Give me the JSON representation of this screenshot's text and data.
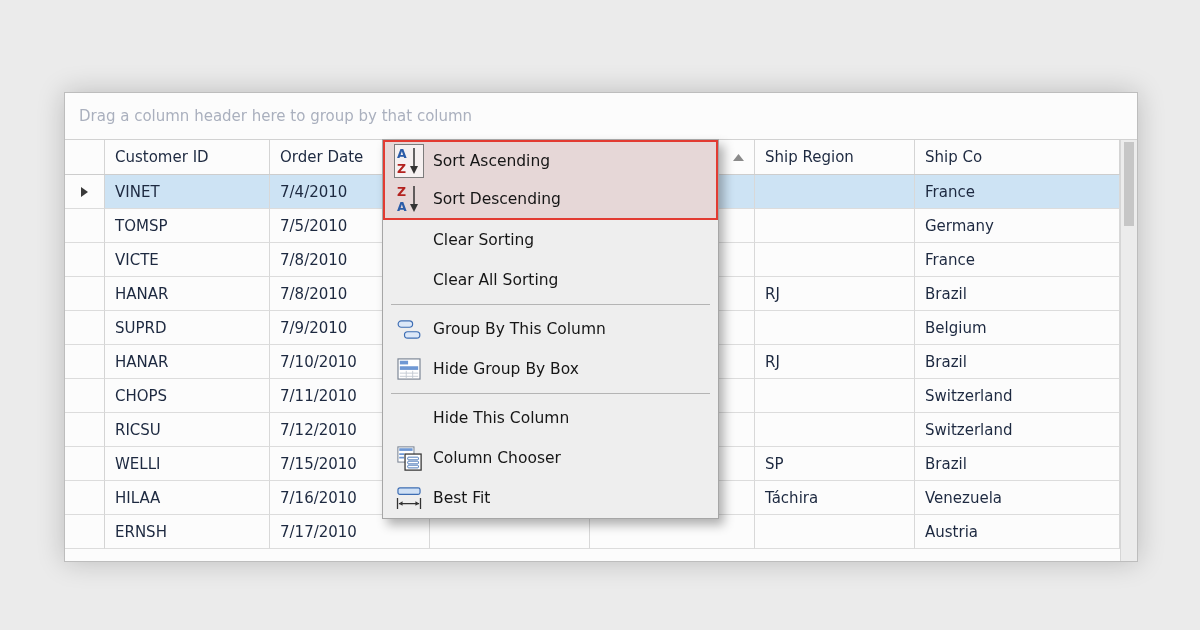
{
  "group_panel": {
    "hint": "Drag a column header here to group by that column"
  },
  "columns": [
    {
      "header": "Customer ID",
      "sorted": false
    },
    {
      "header": "Order Date",
      "sorted": false
    },
    {
      "sorted": true
    },
    {
      "header": "Ship Region",
      "sorted": false
    },
    {
      "header": "Ship Co",
      "sorted": false
    }
  ],
  "rows": [
    {
      "selected": true,
      "customer_id": "VINET",
      "order_date": "7/4/2010",
      "column_6": "France"
    },
    {
      "selected": false,
      "customer_id": "TOMSP",
      "order_date": "7/5/2010",
      "column_6": "Germany"
    },
    {
      "selected": false,
      "customer_id": "VICTE",
      "order_date": "7/8/2010",
      "column_6": "France"
    },
    {
      "selected": false,
      "customer_id": "HANAR",
      "order_date": "7/8/2010",
      "ship_region": "RJ",
      "column_6": "Brazil"
    },
    {
      "selected": false,
      "customer_id": "SUPRD",
      "order_date": "7/9/2010",
      "column_6": "Belgium"
    },
    {
      "selected": false,
      "customer_id": "HANAR",
      "order_date": "7/10/2010",
      "ship_region": "RJ",
      "column_6": "Brazil"
    },
    {
      "selected": false,
      "customer_id": "CHOPS",
      "order_date": "7/11/2010",
      "column_6": "Switzerland"
    },
    {
      "selected": false,
      "customer_id": "RICSU",
      "order_date": "7/12/2010",
      "column_6": "Switzerland"
    },
    {
      "selected": false,
      "customer_id": "WELLI",
      "order_date": "7/15/2010",
      "ship_region": "SP",
      "column_6": "Brazil"
    },
    {
      "selected": false,
      "customer_id": "HILAA",
      "order_date": "7/16/2010",
      "ship_region": "Táchira",
      "column_6": "Venezuela"
    },
    {
      "selected": false,
      "customer_id": "ERNSH",
      "order_date": "7/17/2010",
      "column_6": "Austria"
    }
  ],
  "context_menu": {
    "sections": [
      [
        {
          "kind": "ascending",
          "label": "Sort Ascending",
          "letters": [
            "A",
            "Z"
          ],
          "checked": true,
          "highlighted": true
        },
        {
          "kind": "descending",
          "label": "Sort Descending",
          "letters": [
            "Z",
            "A"
          ],
          "checked": false,
          "highlighted": true
        },
        {
          "kind": "plain",
          "label": "Clear Sorting",
          "highlighted": false
        },
        {
          "kind": "plain",
          "label": "Clear All Sorting",
          "highlighted": false
        }
      ],
      [
        {
          "kind": "grouping",
          "label": "Group By This Column",
          "highlighted": false
        },
        {
          "kind": "groupbox",
          "label": "Hide Group By Box",
          "highlighted": false
        }
      ],
      [
        {
          "kind": "plain",
          "label": "Hide This Column",
          "highlighted": false
        },
        {
          "kind": "chooser",
          "label": "Column Chooser",
          "highlighted": false
        },
        {
          "kind": "bestfit",
          "label": "Best Fit",
          "highlighted": false
        }
      ]
    ]
  }
}
